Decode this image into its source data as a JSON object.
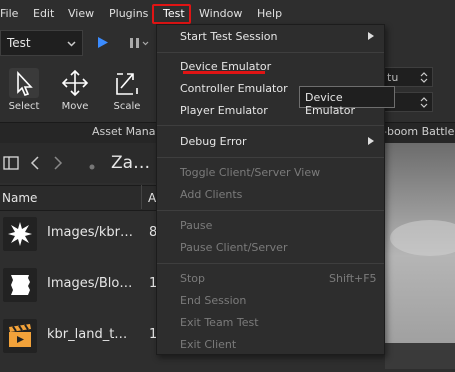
{
  "menubar": {
    "items": [
      "File",
      "Edit",
      "View",
      "Plugins",
      "Test",
      "Window",
      "Help"
    ],
    "open_menu": "Test",
    "highlight_color": "#e01414"
  },
  "toolbar": {
    "mode_value": "Test",
    "play_icon": "play-icon",
    "pause_icon": "pause-icon"
  },
  "ribbon": {
    "tools": [
      {
        "label": "Select",
        "icon": "select-cursor-icon"
      },
      {
        "label": "Move",
        "icon": "move-arrows-icon"
      },
      {
        "label": "Scale",
        "icon": "scale-icon"
      }
    ],
    "section_label": "Asset Manage",
    "battle_label": "-boom Battle",
    "spinner_1": "tu",
    "spinner_2": ""
  },
  "explorer": {
    "path": "Za…",
    "columns": [
      "Name",
      "A"
    ],
    "rows": [
      {
        "name": "Images/kbr…",
        "num": "8",
        "icon": "spiky-burst-image-icon"
      },
      {
        "name": "Images/Blo…",
        "num": "1",
        "icon": "white-block-image-icon"
      },
      {
        "name": "kbr_land_t…",
        "num": "1",
        "icon": "clapper-board-icon"
      }
    ]
  },
  "test_menu": {
    "items": [
      {
        "label": "Start Test Session",
        "enabled": true,
        "submenu": true
      },
      {
        "label": "Device Emulator",
        "enabled": true,
        "hovered": true
      },
      {
        "label": "Controller Emulator",
        "enabled": true
      },
      {
        "label": "Player Emulator",
        "enabled": true
      },
      {
        "label": "Debug Error",
        "enabled": true,
        "submenu": true
      },
      {
        "label": "Toggle Client/Server View",
        "enabled": false
      },
      {
        "label": "Add Clients",
        "enabled": false
      },
      {
        "label": "Pause",
        "enabled": false
      },
      {
        "label": "Pause Client/Server",
        "enabled": false
      },
      {
        "label": "Stop",
        "enabled": false,
        "shortcut": "Shift+F5"
      },
      {
        "label": "End Session",
        "enabled": false
      },
      {
        "label": "Exit Team Test",
        "enabled": false
      },
      {
        "label": "Exit Client",
        "enabled": false
      }
    ]
  },
  "tooltip": {
    "text": "Device Emulator"
  },
  "colors": {
    "accent_red": "#e01414",
    "menu_bg": "#2d2d2d",
    "hover_bg": "#3d3d3d",
    "play_blue": "#3b8cff"
  }
}
